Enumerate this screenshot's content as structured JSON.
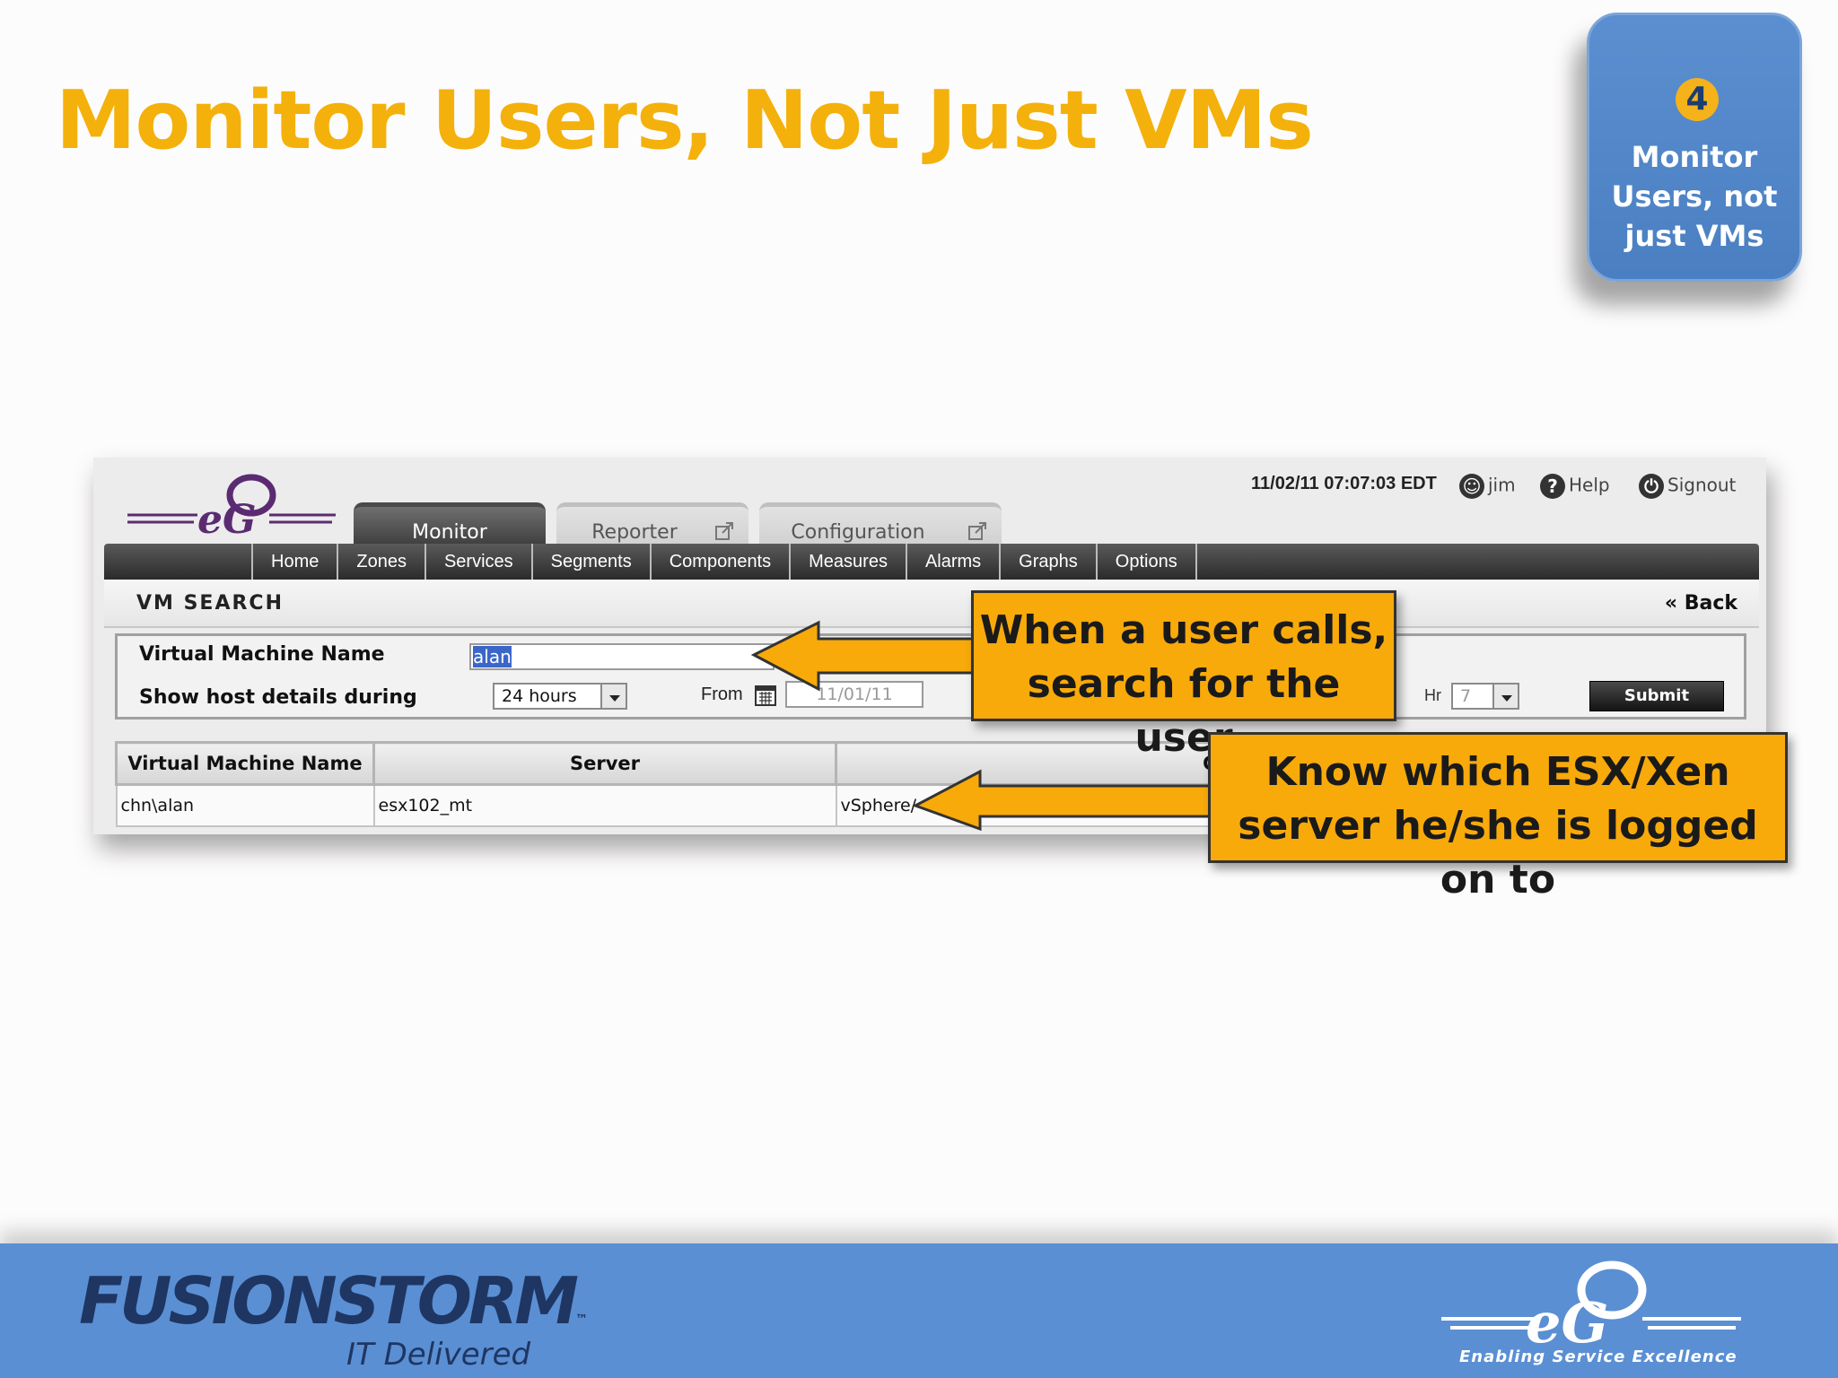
{
  "slide": {
    "title": "Monitor Users, Not Just VMs",
    "badge_number": "4",
    "badge_text": "Monitor Users, not just VMs"
  },
  "app": {
    "tabs": {
      "monitor": "Monitor",
      "reporter": "Reporter",
      "configuration": "Configuration"
    },
    "header": {
      "datetime": "11/02/11 07:07:03 EDT",
      "user": "jim",
      "help": "Help",
      "signout": "Signout"
    },
    "nav": [
      "Home",
      "Zones",
      "Services",
      "Segments",
      "Components",
      "Measures",
      "Alarms",
      "Graphs",
      "Options"
    ],
    "section_title": "VM SEARCH",
    "back_label": "Back",
    "form": {
      "vm_name_label": "Virtual Machine Name",
      "vm_name_value": "alan",
      "host_details_label": "Show host details during",
      "duration_value": "24 hours",
      "from_label": "From",
      "from_date": "11/01/11",
      "hr_label": "Hr",
      "hr_value": "7",
      "submit_label": "Submit"
    },
    "table": {
      "headers": [
        "Virtual Machine Name",
        "Server",
        "Component type"
      ],
      "rows": [
        [
          "chn\\alan",
          "esx102_mt",
          "vSphere/"
        ]
      ]
    }
  },
  "callouts": {
    "search": "When a user calls, search for the user",
    "server": "Know which ESX/Xen server he/she is logged on to"
  },
  "footer": {
    "left_logo": "FUSIONSTORM",
    "left_tagline": "IT Delivered",
    "right_tagline": "Enabling Service Excellence"
  },
  "colors": {
    "title": "#f4b10b",
    "badge": "#4f84c6",
    "callout": "#f8aa0a",
    "footer": "#5a8fd4",
    "navbar": "#3a3a3a"
  }
}
